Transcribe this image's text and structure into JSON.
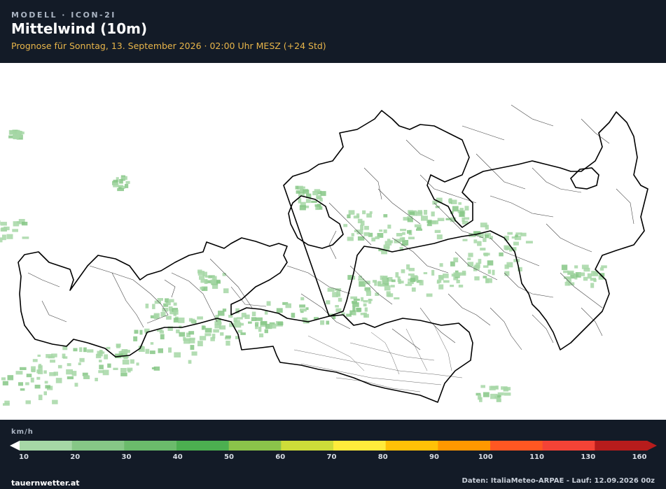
{
  "header": {
    "kicker": "MODELL · ICON-2I",
    "title": "Mittelwind (10m)",
    "subtitle": "Prognose für Sonntag, 13. September 2026 · 02:00 Uhr MESZ  (+24 Std)"
  },
  "legend": {
    "unit": "km/h",
    "ticks": [
      "10",
      "20",
      "30",
      "40",
      "50",
      "60",
      "70",
      "80",
      "90",
      "100",
      "110",
      "130",
      "160"
    ],
    "colors": [
      "#a6d7a6",
      "#86c786",
      "#6bbb6b",
      "#4caf50",
      "#8bc34a",
      "#cddc39",
      "#ffeb3b",
      "#ffc107",
      "#ff9800",
      "#ff5722",
      "#f44336",
      "#b71c1c"
    ]
  },
  "map": {
    "region": "Österreich",
    "background": "#ffffff",
    "wind_color_light": "#a6d7a6",
    "wind_color_mid": "#86c786",
    "border_color": "#000000"
  },
  "footer": {
    "source": "tauernwetter.at",
    "credit": "Daten: ItaliaMeteo-ARPAE - Lauf: 12.09.2026 00z"
  }
}
